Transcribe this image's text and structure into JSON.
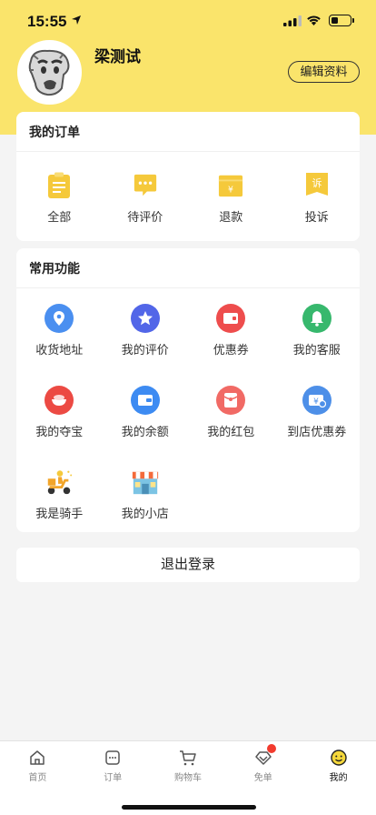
{
  "status": {
    "time": "15:55"
  },
  "profile": {
    "name": "梁测试",
    "edit_label": "编辑资料"
  },
  "orders": {
    "title": "我的订单",
    "items": [
      {
        "label": "全部",
        "icon": "clipboard-icon"
      },
      {
        "label": "待评价",
        "icon": "comment-icon"
      },
      {
        "label": "退款",
        "icon": "refund-icon"
      },
      {
        "label": "投诉",
        "icon": "complaint-icon"
      }
    ]
  },
  "functions": {
    "title": "常用功能",
    "items": [
      {
        "label": "收货地址",
        "icon": "location-icon",
        "color": "#4a8ff0"
      },
      {
        "label": "我的评价",
        "icon": "star-icon",
        "color": "#5266e8"
      },
      {
        "label": "优惠券",
        "icon": "coupon-icon",
        "color": "#ee4d4d"
      },
      {
        "label": "我的客服",
        "icon": "bell-icon",
        "color": "#37b86d"
      },
      {
        "label": "我的夺宝",
        "icon": "treasure-icon",
        "color": "#ec4a43"
      },
      {
        "label": "我的余额",
        "icon": "wallet-icon",
        "color": "#3d8bf2"
      },
      {
        "label": "我的红包",
        "icon": "red-packet-icon",
        "color": "#f16a65"
      },
      {
        "label": "到店优惠券",
        "icon": "store-coupon-icon",
        "color": "#4d8fe8"
      },
      {
        "label": "我是骑手",
        "icon": "rider-icon",
        "color": "#f2a52a"
      },
      {
        "label": "我的小店",
        "icon": "shop-icon",
        "color": "#f46a3a"
      }
    ]
  },
  "logout_label": "退出登录",
  "tabbar": {
    "items": [
      {
        "label": "首页",
        "icon": "home-icon"
      },
      {
        "label": "订单",
        "icon": "order-icon"
      },
      {
        "label": "购物车",
        "icon": "cart-icon"
      },
      {
        "label": "免单",
        "icon": "free-order-icon"
      },
      {
        "label": "我的",
        "icon": "smile-icon"
      }
    ],
    "active": "我的"
  },
  "colors": {
    "brand_yellow": "#fae46b",
    "accent_yellow": "#f5c93b",
    "badge_red": "#f23b2e"
  }
}
